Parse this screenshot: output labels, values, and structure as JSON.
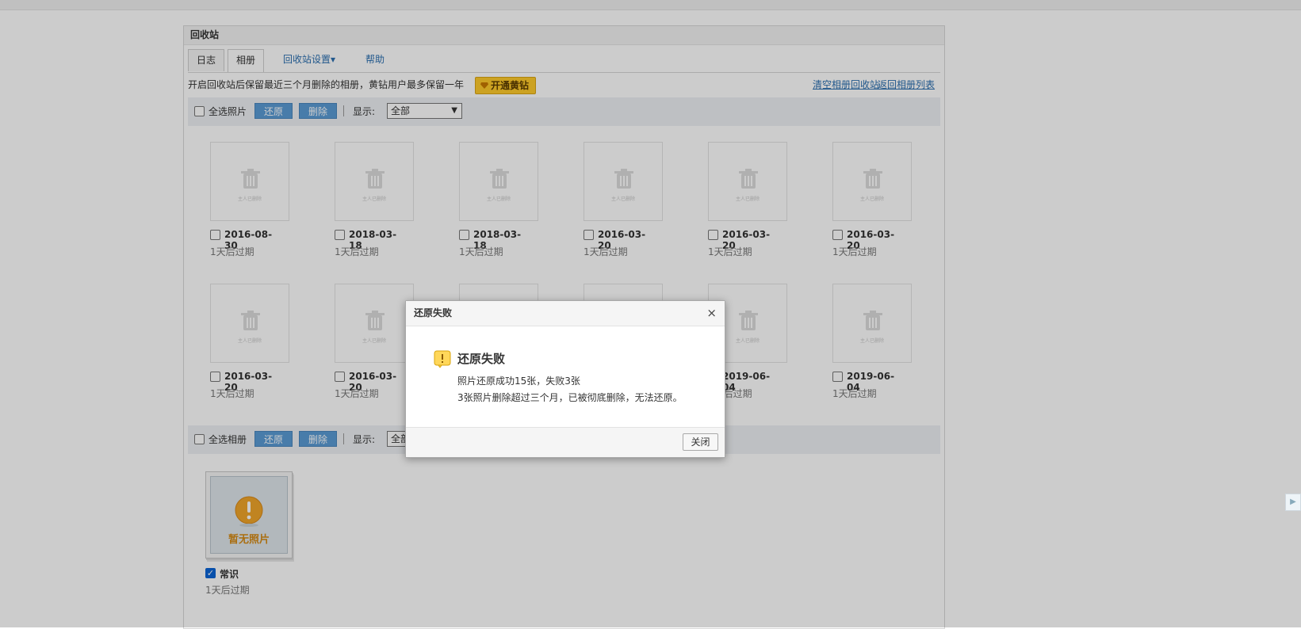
{
  "panel": {
    "title": "回收站"
  },
  "tabs": [
    {
      "label": "日志"
    },
    {
      "label": "相册"
    }
  ],
  "tab_links": [
    {
      "label": "回收站设置▾"
    },
    {
      "label": "帮助"
    }
  ],
  "info": {
    "text": "开启回收站后保留最近三个月删除的相册，黄钻用户最多保留一年",
    "vip_button": "开通黄钻",
    "clear_link": "清空相册回收站",
    "back_link": "返回相册列表"
  },
  "photo_toolbar": {
    "select_all": "全选照片",
    "restore": "还原",
    "delete": "删除",
    "show_label": "显示:",
    "show_value": "全部"
  },
  "album_toolbar": {
    "select_all": "全选相册",
    "restore": "还原",
    "delete": "删除",
    "show_label": "显示:",
    "show_value": "全部"
  },
  "deleted_placeholder": "主人已删除",
  "photos_row1": [
    {
      "date": "2016-08-30",
      "expiry": "1天后过期"
    },
    {
      "date": "2018-03-18",
      "expiry": "1天后过期"
    },
    {
      "date": "2018-03-18",
      "expiry": "1天后过期"
    },
    {
      "date": "2016-03-20",
      "expiry": "1天后过期"
    },
    {
      "date": "2016-03-20",
      "expiry": "1天后过期"
    },
    {
      "date": "2016-03-20",
      "expiry": "1天后过期"
    }
  ],
  "photos_row2": [
    {
      "date": "2016-03-20",
      "expiry": "1天后过期"
    },
    {
      "date": "2016-03-20",
      "expiry": "1天后过期"
    },
    {
      "date": "",
      "expiry": ""
    },
    {
      "date": "",
      "expiry": ""
    },
    {
      "date": "2019-06-04",
      "expiry": "1天后过期"
    },
    {
      "date": "2019-06-04",
      "expiry": "1天后过期"
    }
  ],
  "album": {
    "placeholder": "暂无照片",
    "name": "常识",
    "expiry": "1天后过期",
    "checked": true
  },
  "dialog": {
    "header": "还原失败",
    "close_icon": "×",
    "title": "还原失败",
    "line1": "照片还原成功15张，失败3张",
    "line2": "3张照片删除超过三个月，已被彻底删除，无法还原。",
    "button": "关闭"
  },
  "side_tab_icon": "▶",
  "colors": {
    "accent": "#5b9bd5",
    "link": "#2b6fb0",
    "vip": "#ffcb2b",
    "warning": "#f0b400"
  }
}
